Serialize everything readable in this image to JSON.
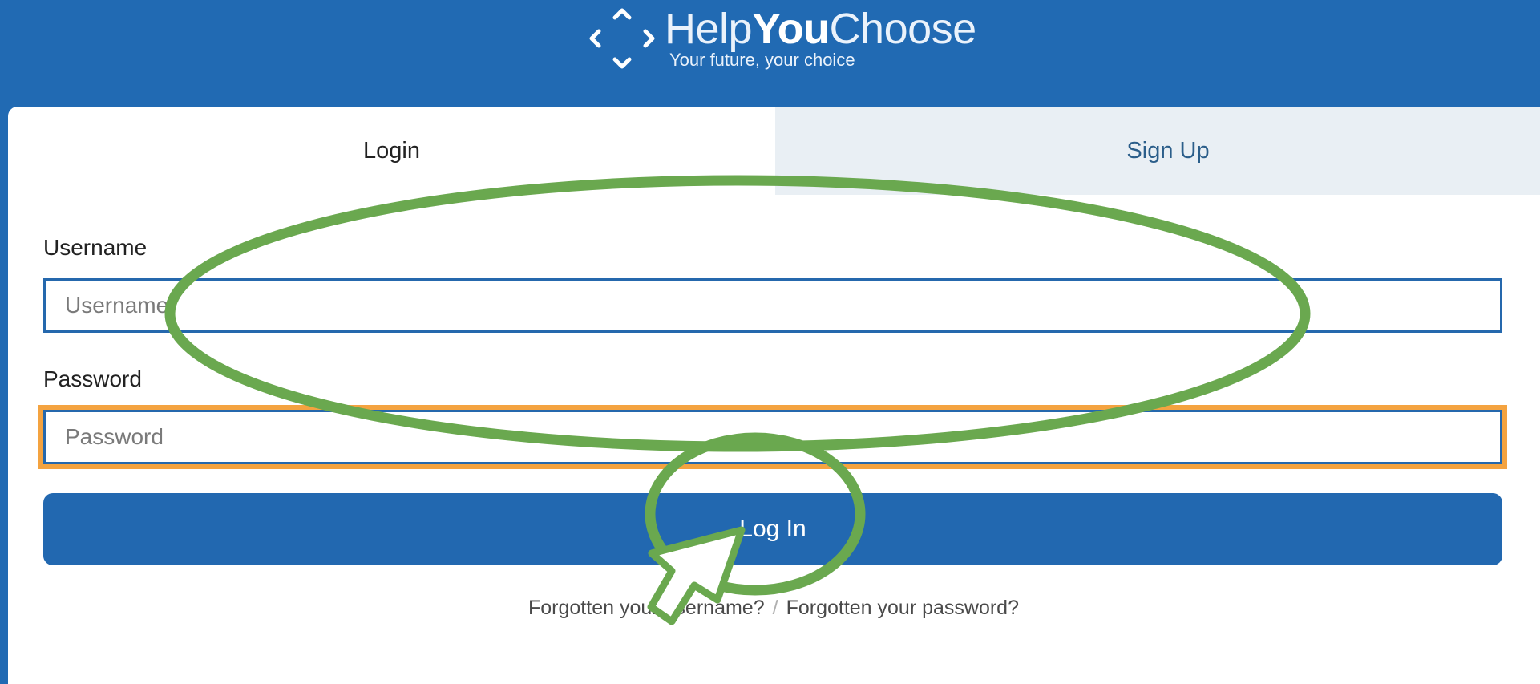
{
  "header": {
    "brand_part1": "Help",
    "brand_part2": "You",
    "brand_part3": "Choose",
    "tagline": "Your future, your choice",
    "logo_icon": "diamond-arrows-icon",
    "background_color": "#216ab3"
  },
  "tabs": {
    "login_label": "Login",
    "signup_label": "Sign Up",
    "active": "Login"
  },
  "form": {
    "username_label": "Username",
    "username_placeholder": "Username",
    "username_value": "",
    "password_label": "Password",
    "password_placeholder": "Password",
    "password_value": "",
    "submit_label": "Log In",
    "focused_field": "Password"
  },
  "links": {
    "forgot_username": "Forgotten your username?",
    "separator": "/",
    "forgot_password": "Forgotten your password?"
  },
  "annotations": {
    "ellipse_color": "#6aa84f",
    "cursor_icon": "arrow-cursor-icon"
  },
  "colors": {
    "brand_blue": "#216ab3",
    "focus_outline": "#f4a340",
    "inactive_tab_bg": "#e9eff4"
  }
}
